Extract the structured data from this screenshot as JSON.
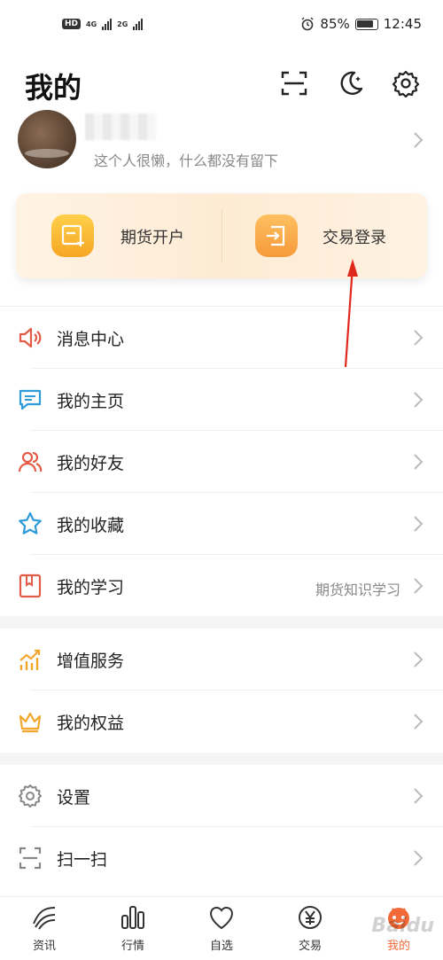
{
  "status_bar": {
    "hd_badge": "HD",
    "net1": "4G",
    "net2": "2G",
    "battery_percent": "85%",
    "time": "12:45"
  },
  "header": {
    "title": "我的"
  },
  "profile": {
    "bio": "这个人很懒，什么都没有留下"
  },
  "account_card": {
    "open_label": "期货开户",
    "login_label": "交易登录"
  },
  "menu_group_1": [
    {
      "label": "消息中心",
      "icon": "speaker-icon"
    },
    {
      "label": "我的主页",
      "icon": "chat-bubble-icon"
    },
    {
      "label": "我的好友",
      "icon": "friends-icon"
    },
    {
      "label": "我的收藏",
      "icon": "star-icon"
    },
    {
      "label": "我的学习",
      "icon": "book-icon",
      "sub": "期货知识学习"
    }
  ],
  "menu_group_2": [
    {
      "label": "增值服务",
      "icon": "growth-chart-icon"
    },
    {
      "label": "我的权益",
      "icon": "crown-icon"
    }
  ],
  "menu_group_3": [
    {
      "label": "设置",
      "icon": "gear-icon"
    },
    {
      "label": "扫一扫",
      "icon": "scan-icon"
    }
  ],
  "tabs": [
    {
      "label": "资讯",
      "icon": "news-icon"
    },
    {
      "label": "行情",
      "icon": "market-bars-icon"
    },
    {
      "label": "自选",
      "icon": "heart-icon"
    },
    {
      "label": "交易",
      "icon": "yen-coin-icon"
    },
    {
      "label": "我的",
      "icon": "mascot-icon",
      "active": true
    }
  ],
  "watermark": "Baidu",
  "colors": {
    "accent": "#f26a38",
    "card_icon": "#f7b733",
    "card_bg": "#fdebd4"
  }
}
